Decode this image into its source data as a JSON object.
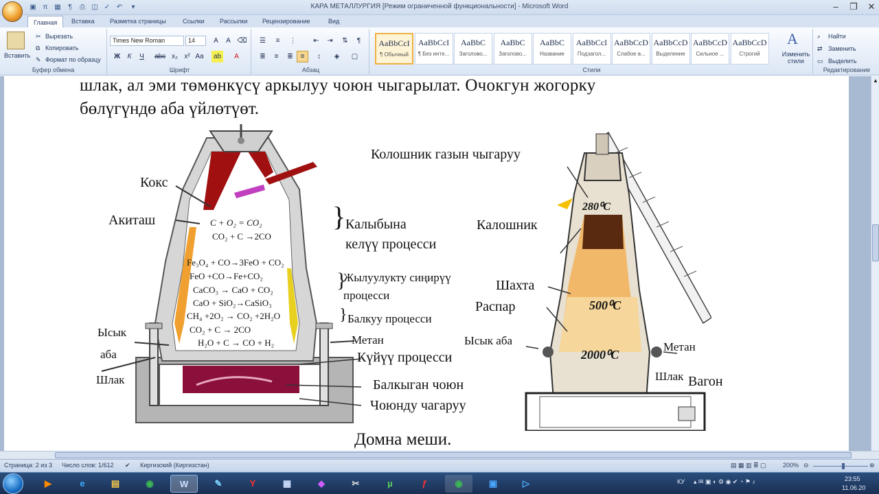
{
  "window": {
    "title": "КАРА МЕТАЛЛУРГИЯ [Режим ограниченной функциональности] - Microsoft Word"
  },
  "tabs": [
    "Главная",
    "Вставка",
    "Разметка страницы",
    "Ссылки",
    "Рассылки",
    "Рецензирование",
    "Вид"
  ],
  "ribbon": {
    "clipboard": {
      "label": "Буфер обмена",
      "paste": "Вставить",
      "cut": "Вырезать",
      "copy": "Копировать",
      "format_painter": "Формат по образцу"
    },
    "font": {
      "label": "Шрифт",
      "family": "Times New Roman",
      "size": "14"
    },
    "paragraph": {
      "label": "Абзац"
    },
    "styles": {
      "label": "Стили",
      "items": [
        {
          "sample": "AaBbCcI",
          "name": "¶ Обычный"
        },
        {
          "sample": "AaBbCcI",
          "name": "¶ Без инте..."
        },
        {
          "sample": "AaBbC",
          "name": "Заголово..."
        },
        {
          "sample": "AaBbC",
          "name": "Заголово..."
        },
        {
          "sample": "AaBbC",
          "name": "Название"
        },
        {
          "sample": "AaBbCcI",
          "name": "Подзагол..."
        },
        {
          "sample": "AaBbCcD",
          "name": "Слабое в..."
        },
        {
          "sample": "AaBbCcD",
          "name": "Выделение"
        },
        {
          "sample": "AaBbCcD",
          "name": "Сильное ..."
        },
        {
          "sample": "AaBbCcD",
          "name": "Строгий"
        }
      ],
      "change": "Изменить стили"
    },
    "editing": {
      "label": "Редактирование",
      "find": "Найти",
      "replace": "Заменить",
      "select": "Выделить"
    }
  },
  "document": {
    "line1": "шлак,  ал  эми  төмөнкүсү  аркылуу  чоюн  чыгарылат.  Очокгун  жогорку",
    "line2": "бөлүгүндө аба үйлөтүөт.",
    "caption": "Домна меши.",
    "left_labels": {
      "koks": "Кокс",
      "akitash": "Акиташ",
      "ysyk": "Ысык",
      "aba": "аба",
      "shlak": "Шлак",
      "metan": "Метан",
      "kalybyna": "Калыбына",
      "kelyu": "келүү процесси",
      "jyluu": "Жылуулукту сиңирүү",
      "jyluu2": "процесси",
      "balkuu": "Балкуу процесси",
      "kuyuu": "Күйүү процесси",
      "balkygan": "Балкыган чоюн",
      "choyun": "Чоюнду чагаруу"
    },
    "equations": [
      "C + O₂ = CO₂",
      "CO₂ + C →2CO",
      "Fe₃O₄ + CO→3FeO + CO₂",
      "FeO +CO→Fe+CO₂",
      "CaCO₃ → CaO + CO₂",
      "CaO + SiO₂→CaSiO₃",
      "CH₄ +2O₂ → CO₂ +2H₂O",
      "CO₂ + C → 2CO",
      "H₂O + C → CO + H₂"
    ],
    "right_labels": {
      "koloshnik_gaz": "Колошник газын чыгаруу",
      "kaloshnik": "Калошник",
      "shahta": "Шахта",
      "raspar": "Распар",
      "ysyk_aba": "Ысык аба",
      "metan": "Метан",
      "shlak": "Шлак",
      "vagon": "Вагон",
      "t1": "280⁰C",
      "t2": "500⁰C",
      "t3": "2000⁰C"
    }
  },
  "status": {
    "page": "Страница: 2 из 3",
    "words": "Число слов: 1/612",
    "lang": "Киргизский (Киргизстан)",
    "zoom": "200%"
  },
  "taskbar": {
    "lang": "КУ",
    "time": "23:55",
    "date": "11.06.20"
  }
}
